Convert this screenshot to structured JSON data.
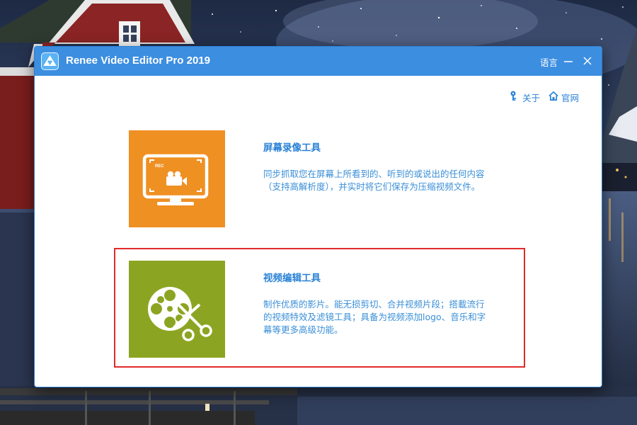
{
  "window": {
    "title": "Renee Video Editor Pro 2019",
    "app_icon": "app-logo-icon",
    "controls": {
      "language_label": "语言",
      "minimize_icon": "minimize-icon",
      "close_icon": "close-icon"
    }
  },
  "top_links": {
    "about_label": "关于",
    "about_icon": "info-key-icon",
    "website_label": "官网",
    "website_icon": "home-icon"
  },
  "features": [
    {
      "title": "屏幕录像工具",
      "description_lines": [
        "同步抓取您在屏幕上所看到的、听到的或说出的任何内容",
        "（支持高解析度），并实时将它们保存为压缩视频文件。"
      ],
      "tile_color": "#ef9023",
      "icon": "screen-record-icon",
      "icon_text": "REC"
    },
    {
      "title": "视频编辑工具",
      "description_lines": [
        "制作优质的影片。能无损剪切、合并视频片段；搭載流行",
        "的视频特效及滤镜工具；具备为视频添加logo、音乐和字",
        "幕等更多高级功能。"
      ],
      "tile_color": "#8ba522",
      "icon": "film-reel-scissors-icon",
      "highlighted": true
    }
  ],
  "colors": {
    "titlebar": "#3c8ee0",
    "link_blue": "#2a82d6",
    "highlight_border": "#e02a2a"
  }
}
